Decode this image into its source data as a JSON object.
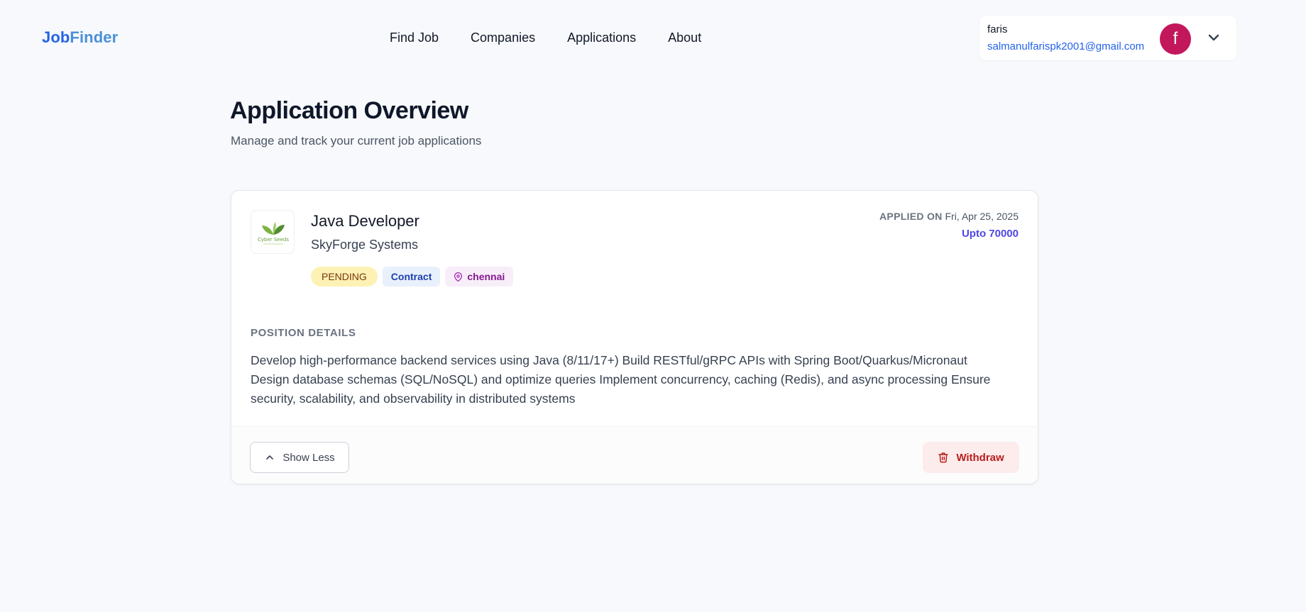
{
  "header": {
    "brand_part1": "Job",
    "brand_part2": "Finder",
    "nav": [
      "Find Job",
      "Companies",
      "Applications",
      "About"
    ],
    "user": {
      "name": "faris",
      "email": "salmanulfarispk2001@gmail.com",
      "avatar_initial": "f",
      "avatar_color": "#c2185b"
    }
  },
  "page": {
    "title": "Application Overview",
    "subtitle": "Manage and track your current job applications"
  },
  "application": {
    "logo_text": "Cyber Seeds",
    "job_title": "Java Developer",
    "company": "SkyForge Systems",
    "status": "PENDING",
    "job_type": "Contract",
    "location": "chennai",
    "applied_label": "APPLIED ON",
    "applied_date": "Fri, Apr 25, 2025",
    "salary": "Upto 70000",
    "section_label": "POSITION DETAILS",
    "description": "Develop high-performance backend services using Java (8/11/17+) Build RESTful/gRPC APIs with Spring Boot/Quarkus/Micronaut Design database schemas (SQL/NoSQL) and optimize queries Implement concurrency, caching (Redis), and async processing Ensure security, scalability, and observability in distributed systems",
    "show_less_label": "Show Less",
    "withdraw_label": "Withdraw"
  },
  "icons": {
    "user_menu": "chevron-down-icon",
    "location": "map-pin-icon",
    "show_less": "chevron-up-icon",
    "withdraw": "trash-icon"
  },
  "colors": {
    "brand": "#2563eb",
    "accent_salary": "#4f46e5",
    "status_pending_bg": "#fdf2b3",
    "withdraw_text": "#b91c1c"
  }
}
